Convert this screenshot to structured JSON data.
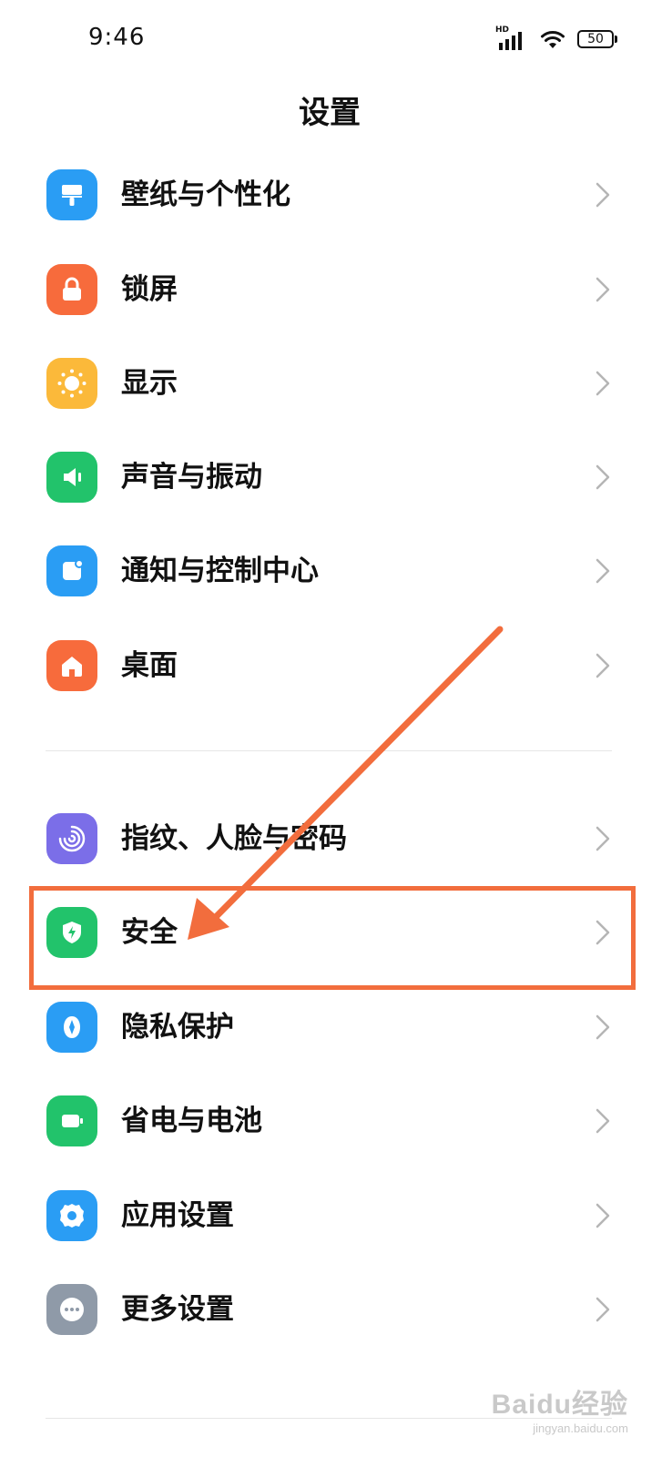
{
  "status_bar": {
    "time": "9:46",
    "network_badge": "HD",
    "battery": "50"
  },
  "header": {
    "title": "设置"
  },
  "groups": [
    {
      "items": [
        {
          "label": "壁纸与个性化",
          "icon": "wallpaper-icon",
          "color": "#2a9df4"
        },
        {
          "label": "锁屏",
          "icon": "lock-icon",
          "color": "#f76b3c"
        },
        {
          "label": "显示",
          "icon": "sun-icon",
          "color": "#fbb93a"
        },
        {
          "label": "声音与振动",
          "icon": "speaker-icon",
          "color": "#22c36b"
        },
        {
          "label": "通知与控制中心",
          "icon": "notification-icon",
          "color": "#2a9df4"
        },
        {
          "label": "桌面",
          "icon": "home-icon",
          "color": "#f76b3c"
        }
      ]
    },
    {
      "items": [
        {
          "label": "指纹、人脸与密码",
          "icon": "fingerprint-icon",
          "color": "#7b6ee8"
        },
        {
          "label": "安全",
          "icon": "shield-icon",
          "color": "#22c36b"
        },
        {
          "label": "隐私保护",
          "icon": "privacy-icon",
          "color": "#2a9df4"
        },
        {
          "label": "省电与电池",
          "icon": "battery-icon",
          "color": "#22c36b"
        },
        {
          "label": "应用设置",
          "icon": "gear-icon",
          "color": "#2a9df4"
        },
        {
          "label": "更多设置",
          "icon": "more-icon",
          "color": "#8f9aa8"
        }
      ]
    }
  ],
  "annotation": {
    "highlight_color": "#f26d3d",
    "highlighted_item": "安全"
  },
  "watermark": {
    "main": "Baidu经验",
    "sub": "jingyan.baidu.com"
  }
}
